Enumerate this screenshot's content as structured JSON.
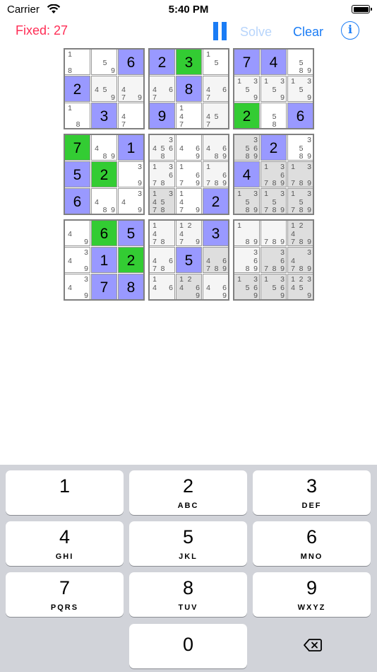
{
  "status_bar": {
    "carrier": "Carrier",
    "time": "5:40 PM"
  },
  "toolbar": {
    "fixed_label": "Fixed: 27",
    "solve_label": "Solve",
    "clear_label": "Clear",
    "info_glyph": "i"
  },
  "icons": {
    "pause": "pause-icon",
    "info": "info-icon",
    "wifi": "wifi-icon",
    "battery": "battery-icon",
    "delete": "delete-backspace-icon"
  },
  "colors": {
    "assigned": "#9999ff",
    "fixed_green": "#33cc33",
    "accent": "#1a7cf5",
    "fixed_text": "#ff2d55",
    "solve_disabled": "#b8d5fb"
  },
  "grid": [
    [
      {
        "n": [
          "1",
          "",
          "",
          "",
          "",
          "",
          "8"
        ]
      },
      {
        "n": [
          "",
          "",
          "",
          "",
          "5",
          "",
          "",
          "",
          "9"
        ]
      },
      {
        "v": "6",
        "c": "assigned"
      },
      {
        "v": "2",
        "c": "assigned"
      },
      {
        "v": "3",
        "c": "green"
      },
      {
        "n": [
          "1",
          "",
          "",
          "",
          "5"
        ]
      },
      {
        "v": "7",
        "c": "assigned"
      },
      {
        "v": "4",
        "c": "assigned"
      },
      {
        "n": [
          "",
          "",
          "",
          "",
          "5",
          "",
          "",
          "8",
          "9"
        ]
      }
    ],
    [
      {
        "v": "2",
        "c": "assigned"
      },
      {
        "n": [
          "",
          "",
          "",
          "4",
          "5",
          "",
          "",
          "",
          "9"
        ],
        "c": "light"
      },
      {
        "n": [
          "",
          "",
          "",
          "4",
          "",
          "",
          "7",
          "",
          "9"
        ],
        "c": "light"
      },
      {
        "n": [
          "",
          "",
          "",
          "4",
          "",
          "6",
          "7"
        ],
        "c": "light"
      },
      {
        "v": "8",
        "c": "assigned"
      },
      {
        "n": [
          "",
          "",
          "",
          "4",
          "",
          "6",
          "7"
        ],
        "c": "light"
      },
      {
        "n": [
          "1",
          "",
          "3",
          "",
          "5",
          "",
          "",
          "",
          "9"
        ],
        "c": "light"
      },
      {
        "n": [
          "1",
          "",
          "3",
          "",
          "5",
          "",
          "",
          "",
          "9"
        ],
        "c": "light"
      },
      {
        "n": [
          "1",
          "",
          "3",
          "",
          "5",
          "",
          "",
          "",
          "9"
        ],
        "c": "light"
      }
    ],
    [
      {
        "n": [
          "1",
          "",
          "",
          "",
          "",
          "",
          "",
          "8"
        ]
      },
      {
        "v": "3",
        "c": "assigned"
      },
      {
        "n": [
          "",
          "",
          "",
          "4",
          "",
          "",
          "7"
        ]
      },
      {
        "v": "9",
        "c": "assigned"
      },
      {
        "n": [
          "1",
          "",
          "",
          "4",
          "",
          "",
          "7"
        ]
      },
      {
        "n": [
          "",
          "",
          "",
          "4",
          "5",
          "",
          "7"
        ],
        "c": "light"
      },
      {
        "v": "2",
        "c": "green"
      },
      {
        "n": [
          "",
          "",
          "",
          "",
          "5",
          "",
          "",
          "8"
        ]
      },
      {
        "v": "6",
        "c": "assigned"
      }
    ],
    [
      {
        "v": "7",
        "c": "green"
      },
      {
        "n": [
          "",
          "",
          "",
          "4",
          "",
          "",
          "",
          "8",
          "9"
        ]
      },
      {
        "v": "1",
        "c": "assigned"
      },
      {
        "n": [
          "",
          "",
          "3",
          "4",
          "5",
          "6",
          "",
          "8"
        ],
        "c": "light"
      },
      {
        "n": [
          "",
          "",
          "",
          "4",
          "",
          "6",
          "",
          "",
          "9"
        ]
      },
      {
        "n": [
          "",
          "",
          "",
          "4",
          "",
          "6",
          "",
          "8",
          "9"
        ],
        "c": "light"
      },
      {
        "n": [
          "",
          "",
          "3",
          "",
          "5",
          "6",
          "",
          "8",
          "9"
        ],
        "c": "gray"
      },
      {
        "v": "2",
        "c": "assigned"
      },
      {
        "n": [
          "",
          "",
          "3",
          "",
          "5",
          "",
          "",
          "8",
          "9"
        ]
      }
    ],
    [
      {
        "v": "5",
        "c": "assigned"
      },
      {
        "v": "2",
        "c": "green"
      },
      {
        "n": [
          "",
          "",
          "3",
          "",
          "",
          "",
          "",
          "",
          "9"
        ]
      },
      {
        "n": [
          "1",
          "",
          "3",
          "",
          "",
          "6",
          "7",
          "8"
        ],
        "c": "light"
      },
      {
        "n": [
          "1",
          "",
          "",
          "",
          "",
          "6",
          "7",
          "",
          "9"
        ]
      },
      {
        "n": [
          "1",
          "",
          "",
          "",
          "",
          "6",
          "7",
          "8",
          "9"
        ],
        "c": "light"
      },
      {
        "v": "4",
        "c": "assigned"
      },
      {
        "n": [
          "1",
          "",
          "3",
          "",
          "",
          "6",
          "7",
          "8",
          "9"
        ],
        "c": "gray"
      },
      {
        "n": [
          "1",
          "",
          "3",
          "",
          "",
          "",
          "7",
          "8",
          "9"
        ],
        "c": "gray"
      }
    ],
    [
      {
        "v": "6",
        "c": "assigned"
      },
      {
        "n": [
          "",
          "",
          "",
          "4",
          "",
          "",
          "",
          "8",
          "9"
        ]
      },
      {
        "n": [
          "",
          "",
          "3",
          "4",
          "",
          "",
          "",
          "",
          "9"
        ]
      },
      {
        "n": [
          "1",
          "",
          "3",
          "4",
          "5",
          "",
          "7",
          "8"
        ],
        "c": "gray"
      },
      {
        "n": [
          "1",
          "",
          "",
          "4",
          "",
          "",
          "7",
          "",
          "9"
        ]
      },
      {
        "v": "2",
        "c": "assigned"
      },
      {
        "n": [
          "1",
          "",
          "3",
          "",
          "5",
          "",
          "",
          "8",
          "9"
        ],
        "c": "gray"
      },
      {
        "n": [
          "1",
          "",
          "3",
          "",
          "5",
          "",
          "7",
          "8",
          "9"
        ],
        "c": "gray"
      },
      {
        "n": [
          "1",
          "",
          "3",
          "",
          "5",
          "",
          "7",
          "8",
          "9"
        ],
        "c": "gray"
      }
    ],
    [
      {
        "n": [
          "",
          "",
          "",
          "4",
          "",
          "",
          "",
          "",
          "9"
        ]
      },
      {
        "v": "6",
        "c": "green"
      },
      {
        "v": "5",
        "c": "assigned"
      },
      {
        "n": [
          "1",
          "",
          "",
          "4",
          "",
          "",
          "7",
          "8"
        ],
        "c": "light"
      },
      {
        "n": [
          "1",
          "2",
          "",
          "4",
          "",
          "",
          "7",
          "",
          "9"
        ],
        "c": "light"
      },
      {
        "v": "3",
        "c": "assigned"
      },
      {
        "n": [
          "1",
          "",
          "",
          "",
          "",
          "",
          "",
          "8",
          "9"
        ],
        "c": "light"
      },
      {
        "n": [
          "",
          "",
          "",
          "",
          "",
          "",
          "7",
          "8",
          "9"
        ],
        "c": "light"
      },
      {
        "n": [
          "1",
          "2",
          "",
          "4",
          "",
          "",
          "7",
          "8",
          "9"
        ],
        "c": "gray"
      }
    ],
    [
      {
        "n": [
          "",
          "",
          "3",
          "4",
          "",
          "",
          "",
          "",
          "9"
        ]
      },
      {
        "v": "1",
        "c": "assigned"
      },
      {
        "v": "2",
        "c": "green"
      },
      {
        "n": [
          "",
          "",
          "",
          "4",
          "",
          "6",
          "7",
          "8"
        ],
        "c": "light"
      },
      {
        "v": "5",
        "c": "assigned"
      },
      {
        "n": [
          "",
          "",
          "",
          "4",
          "",
          "6",
          "7",
          "8",
          "9"
        ],
        "c": "gray"
      },
      {
        "n": [
          "",
          "",
          "3",
          "",
          "",
          "6",
          "",
          "8",
          "9"
        ],
        "c": "light"
      },
      {
        "n": [
          "",
          "",
          "3",
          "",
          "",
          "6",
          "7",
          "8",
          "9"
        ],
        "c": "gray"
      },
      {
        "n": [
          "",
          "",
          "3",
          "4",
          "",
          "",
          "7",
          "8",
          "9"
        ],
        "c": "gray"
      }
    ],
    [
      {
        "n": [
          "",
          "",
          "3",
          "4",
          "",
          "",
          "",
          "",
          "9"
        ]
      },
      {
        "v": "7",
        "c": "assigned"
      },
      {
        "v": "8",
        "c": "assigned"
      },
      {
        "n": [
          "1",
          "",
          "",
          "4",
          "",
          "6"
        ],
        "c": "light"
      },
      {
        "n": [
          "1",
          "2",
          "",
          "4",
          "",
          "6",
          "",
          "",
          "9"
        ],
        "c": "gray"
      },
      {
        "n": [
          "",
          "",
          "",
          "4",
          "",
          "6",
          "",
          "",
          "9"
        ],
        "c": "light"
      },
      {
        "n": [
          "1",
          "",
          "3",
          "",
          "5",
          "6",
          "",
          "",
          "9"
        ],
        "c": "gray"
      },
      {
        "n": [
          "1",
          "",
          "3",
          "",
          "5",
          "6",
          "",
          "",
          "9"
        ],
        "c": "gray"
      },
      {
        "n": [
          "1",
          "2",
          "3",
          "4",
          "5",
          "",
          "",
          "",
          "9"
        ],
        "c": "gray"
      }
    ]
  ],
  "keypad": [
    {
      "num": "1",
      "letters": ""
    },
    {
      "num": "2",
      "letters": "ABC"
    },
    {
      "num": "3",
      "letters": "DEF"
    },
    {
      "num": "4",
      "letters": "GHI"
    },
    {
      "num": "5",
      "letters": "JKL"
    },
    {
      "num": "6",
      "letters": "MNO"
    },
    {
      "num": "7",
      "letters": "PQRS"
    },
    {
      "num": "8",
      "letters": "TUV"
    },
    {
      "num": "9",
      "letters": "WXYZ"
    },
    {
      "num": "0",
      "letters": ""
    }
  ]
}
